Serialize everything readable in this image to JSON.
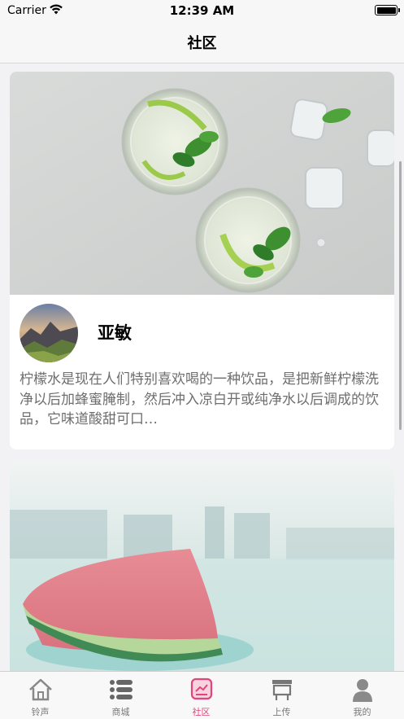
{
  "status_bar": {
    "carrier": "Carrier",
    "time": "12:39 AM"
  },
  "nav": {
    "title": "社区"
  },
  "posts": [
    {
      "image": "lime-mojito-photo",
      "author": "亚敏",
      "text": "柠檬水是现在人们特别喜欢喝的一种饮品，是把新鲜柠檬洗净以后加蜂蜜腌制，然后冲入凉白开或纯净水以后调成的饮品，它味道酸甜可口…"
    },
    {
      "image": "watermelon-photo"
    }
  ],
  "tabs": [
    {
      "label": "铃声",
      "icon": "home-icon",
      "active": false
    },
    {
      "label": "商城",
      "icon": "list-icon",
      "active": false
    },
    {
      "label": "社区",
      "icon": "community-icon",
      "active": true
    },
    {
      "label": "上传",
      "icon": "upload-icon",
      "active": false
    },
    {
      "label": "我的",
      "icon": "person-icon",
      "active": false
    }
  ],
  "colors": {
    "accent": "#e0457b",
    "tab_inactive": "#7a7a7a",
    "background": "#f2f2f4"
  }
}
